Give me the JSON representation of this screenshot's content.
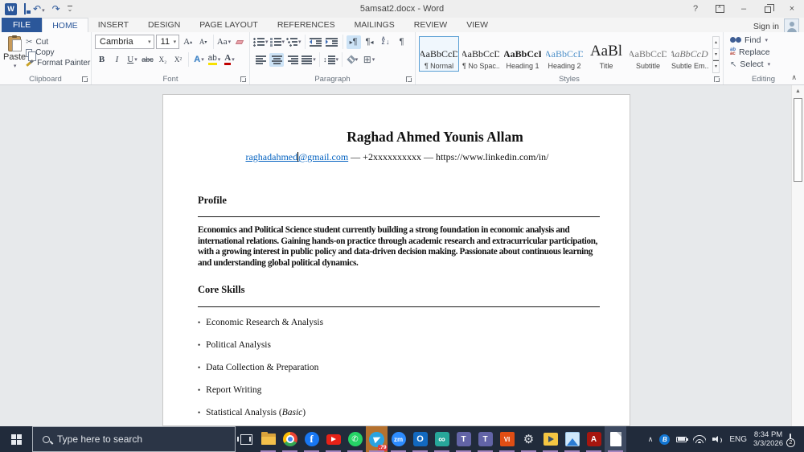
{
  "title_bar": {
    "title": "5amsat2.docx - Word",
    "sign_in": "Sign in"
  },
  "icons": {
    "word_logo": "W",
    "undo": "↶",
    "redo": "↷",
    "dropdown": "▾",
    "qat_more": "⌄",
    "help": "?",
    "ribbon_chevron": "∧",
    "minimize": "–",
    "close": "×",
    "cut": "✂",
    "pilcrow": "¶",
    "ltr_triangle": "▸",
    "rtl_triangle": "◂",
    "updown": "↕",
    "scroll_up": "▴",
    "scroll_down": "▾",
    "collapse": "∧",
    "bullet": "•",
    "borders_grid": "⊞",
    "gear": "⚙",
    "infinity": "∞",
    "select_arrow": "↖",
    "sort_a": "A",
    "sort_z": "Z",
    "arrow_down": "↓",
    "scrollbar_up": "▲",
    "tray_chevron": "∧",
    "bluetooth": "B"
  },
  "ribbon": {
    "tabs": [
      "FILE",
      "HOME",
      "INSERT",
      "DESIGN",
      "PAGE LAYOUT",
      "REFERENCES",
      "MAILINGS",
      "REVIEW",
      "VIEW"
    ],
    "clipboard": {
      "label": "Clipboard",
      "paste": "Paste",
      "cut": "Cut",
      "copy": "Copy",
      "format_painter": "Format Painter"
    },
    "font": {
      "label": "Font",
      "family": "Cambria",
      "size": "11",
      "bold": "B",
      "italic": "I",
      "underline": "U",
      "strikethrough": "abc",
      "subscript": "X₂",
      "superscript": "X²",
      "grow": "A",
      "shrink": "A",
      "change_case": "Aa",
      "effects": "A",
      "highlight": "ab",
      "font_color": "A"
    },
    "paragraph": {
      "label": "Paragraph"
    },
    "styles": {
      "label": "Styles",
      "items": [
        {
          "sample": "AaBbCcD",
          "name": "¶ Normal"
        },
        {
          "sample": "AaBbCcD",
          "name": "¶ No Spac..."
        },
        {
          "sample": "AaBbCcI",
          "name": "Heading 1"
        },
        {
          "sample": "AaBbCcD",
          "name": "Heading 2"
        },
        {
          "sample": "AaBl",
          "name": "Title"
        },
        {
          "sample": "AaBbCcD",
          "name": "Subtitle"
        },
        {
          "sample": "AaBbCcDi",
          "name": "Subtle Em..."
        }
      ]
    },
    "editing": {
      "label": "Editing",
      "find": "Find",
      "replace": "Replace",
      "select": "Select",
      "replace_top": "ab",
      "replace_bottom": "ac"
    }
  },
  "document": {
    "name": "Raghad Ahmed Younis Allam",
    "contact": {
      "email_user": "raghadahmed",
      "email_domain": "@gmail.com",
      "rest": " — +2xxxxxxxxxx — https://www.linkedin.com/in/"
    },
    "profile_heading": "Profile",
    "profile_text": "Economics and Political Science student currently building a strong foundation in economic analysis and international relations. Gaining hands-on practice through academic research and extracurricular participation, with a growing interest in public policy and data-driven decision making. Passionate about continuous learning and understanding global political dynamics.",
    "skills_heading": "Core Skills",
    "skills": [
      "Economic Research & Analysis",
      "Political Analysis",
      "Data Collection & Preparation",
      "Report Writing"
    ],
    "skill_last": {
      "prefix": "Statistical Analysis (",
      "italic": "Basic",
      "suffix": ")"
    }
  },
  "taskbar": {
    "search_placeholder": "Type here to search",
    "zoom_label": "zm",
    "vi_label": "VI",
    "outlook_label": "O",
    "facebook_label": "f",
    "acrobat_label": "A",
    "teams_label": "T",
    "whatsapp_glyph": "✆",
    "telegram_badge": ".79",
    "tray": {
      "language": "ENG",
      "time": "8:34 PM",
      "date": "3/3/2026",
      "notification_count": "2"
    }
  }
}
